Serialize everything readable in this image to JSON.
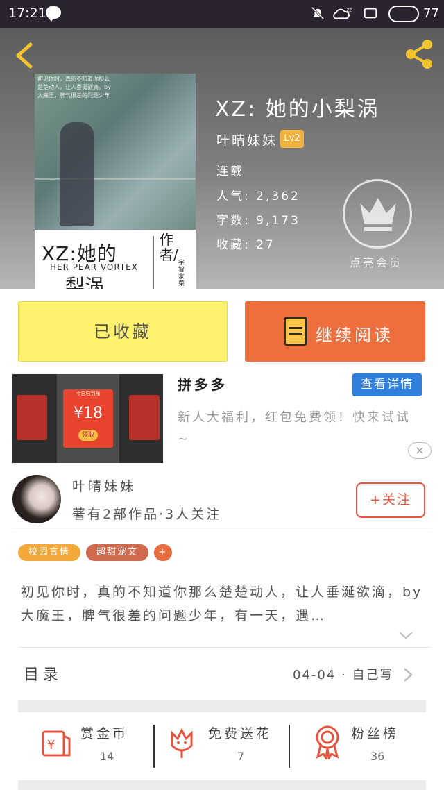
{
  "status_bar": {
    "time": "17:21",
    "battery": "77"
  },
  "book": {
    "title": "XZ: 她的小梨涡",
    "author": "叶晴妹妹",
    "level": "Lv2",
    "status": "连载",
    "popularity_label": "人气:",
    "popularity": "2,362",
    "words_label": "字数:",
    "words": "9,173",
    "collect_label": "收藏:",
    "collect": "27",
    "member_label": "点亮会员"
  },
  "cover": {
    "blurb": "初见你时，真的不知道你那么楚楚动人，让人垂涎欲滴。by大魔王，脾气很差的问题少年",
    "title_line1": "XZ:她的",
    "subtitle": "HER PEAR VORTEX",
    "title_line2": "梨涡",
    "author_mark": "作者/",
    "author_small": "宇智家菜"
  },
  "actions": {
    "collected": "已收藏",
    "continue": "继续阅读"
  },
  "ad": {
    "badge": "今日已到账",
    "amount": "¥18",
    "claim": "领取",
    "title": "拼多多",
    "detail_button": "查看详情",
    "description": "新人大福利，红包免费领！快来试试~",
    "close": "×"
  },
  "writer": {
    "name": "叶晴妹妹",
    "stats": "著有2部作品·3人关注",
    "follow": "+关注"
  },
  "tags": [
    {
      "label": "校园言情",
      "color": "#f2a83a"
    },
    {
      "label": "超甜宠文",
      "color": "#d06a4f"
    },
    {
      "label": "+",
      "color": "#e66c3f"
    }
  ],
  "synopsis": "初见你时，真的不知道你那么楚楚动人，让人垂涎欲滴，by大魔王，脾气很差的问题少年，有一天，遇…",
  "toc": {
    "label": "目录",
    "updated": "04-04 · 自己写"
  },
  "stats": [
    {
      "label": "赏金币",
      "value": "14"
    },
    {
      "label": "免费送花",
      "value": "7"
    },
    {
      "label": "粉丝榜",
      "value": "36"
    }
  ],
  "colors": {
    "accent_orange": "#ee6f3e",
    "collect_yellow": "#fdf16d",
    "ad_blue": "#2f7fdb",
    "follow_red": "#e8533e",
    "level_badge": "#f2b23e"
  }
}
